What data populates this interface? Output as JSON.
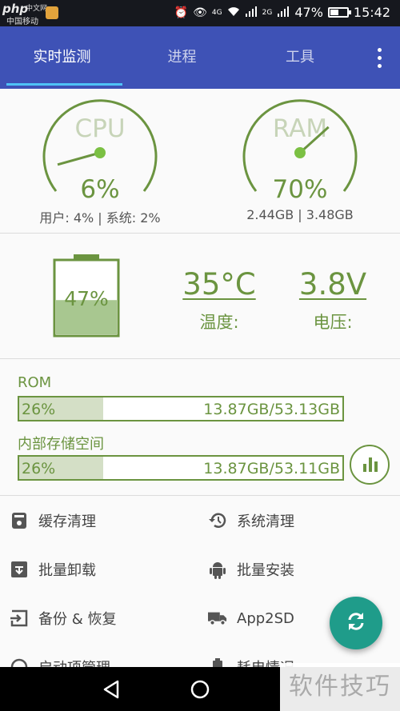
{
  "status_bar": {
    "logo": "php",
    "logo_small": "中文网",
    "carrier": "中国移动",
    "network": "4G",
    "network2": "2G",
    "battery": "47%",
    "time": "15:42"
  },
  "tabs": [
    {
      "label": "实时监测",
      "active": true
    },
    {
      "label": "进程",
      "active": false
    },
    {
      "label": "工具",
      "active": false
    }
  ],
  "cpu": {
    "title": "CPU",
    "value": "6%",
    "detail": "用户: 4% | 系统: 2%",
    "level": 0.06
  },
  "ram": {
    "title": "RAM",
    "value": "70%",
    "detail": "2.44GB | 3.48GB",
    "level": 0.7
  },
  "battery": {
    "value": "47%",
    "level": 0.47
  },
  "temperature": {
    "value": "35°C",
    "label": "温度:"
  },
  "voltage": {
    "value": "3.8V",
    "label": "电压:"
  },
  "rom": {
    "title": "ROM",
    "percent": "26%",
    "size": "13.87GB/53.13GB",
    "level": 0.26
  },
  "internal": {
    "title": "内部存储空间",
    "percent": "26%",
    "size": "13.87GB/53.11GB",
    "level": 0.26
  },
  "tools": [
    {
      "label": "缓存清理",
      "icon": "trash-icon"
    },
    {
      "label": "系统清理",
      "icon": "history-icon"
    },
    {
      "label": "批量卸载",
      "icon": "uninstall-icon"
    },
    {
      "label": "批量安装",
      "icon": "android-icon"
    },
    {
      "label": "备份 & 恢复",
      "icon": "backup-icon"
    },
    {
      "label": "App2SD",
      "icon": "truck-icon"
    },
    {
      "label": "启动项管理",
      "icon": "startup-icon"
    },
    {
      "label": "耗电情况",
      "icon": "battery-usage-icon"
    }
  ],
  "watermark": "软件技巧",
  "colors": {
    "accent_green": "#6b9440",
    "appbar_blue": "#3e52b6",
    "tab_indicator": "#4fc3f7",
    "fab_teal": "#1f9c8a"
  }
}
